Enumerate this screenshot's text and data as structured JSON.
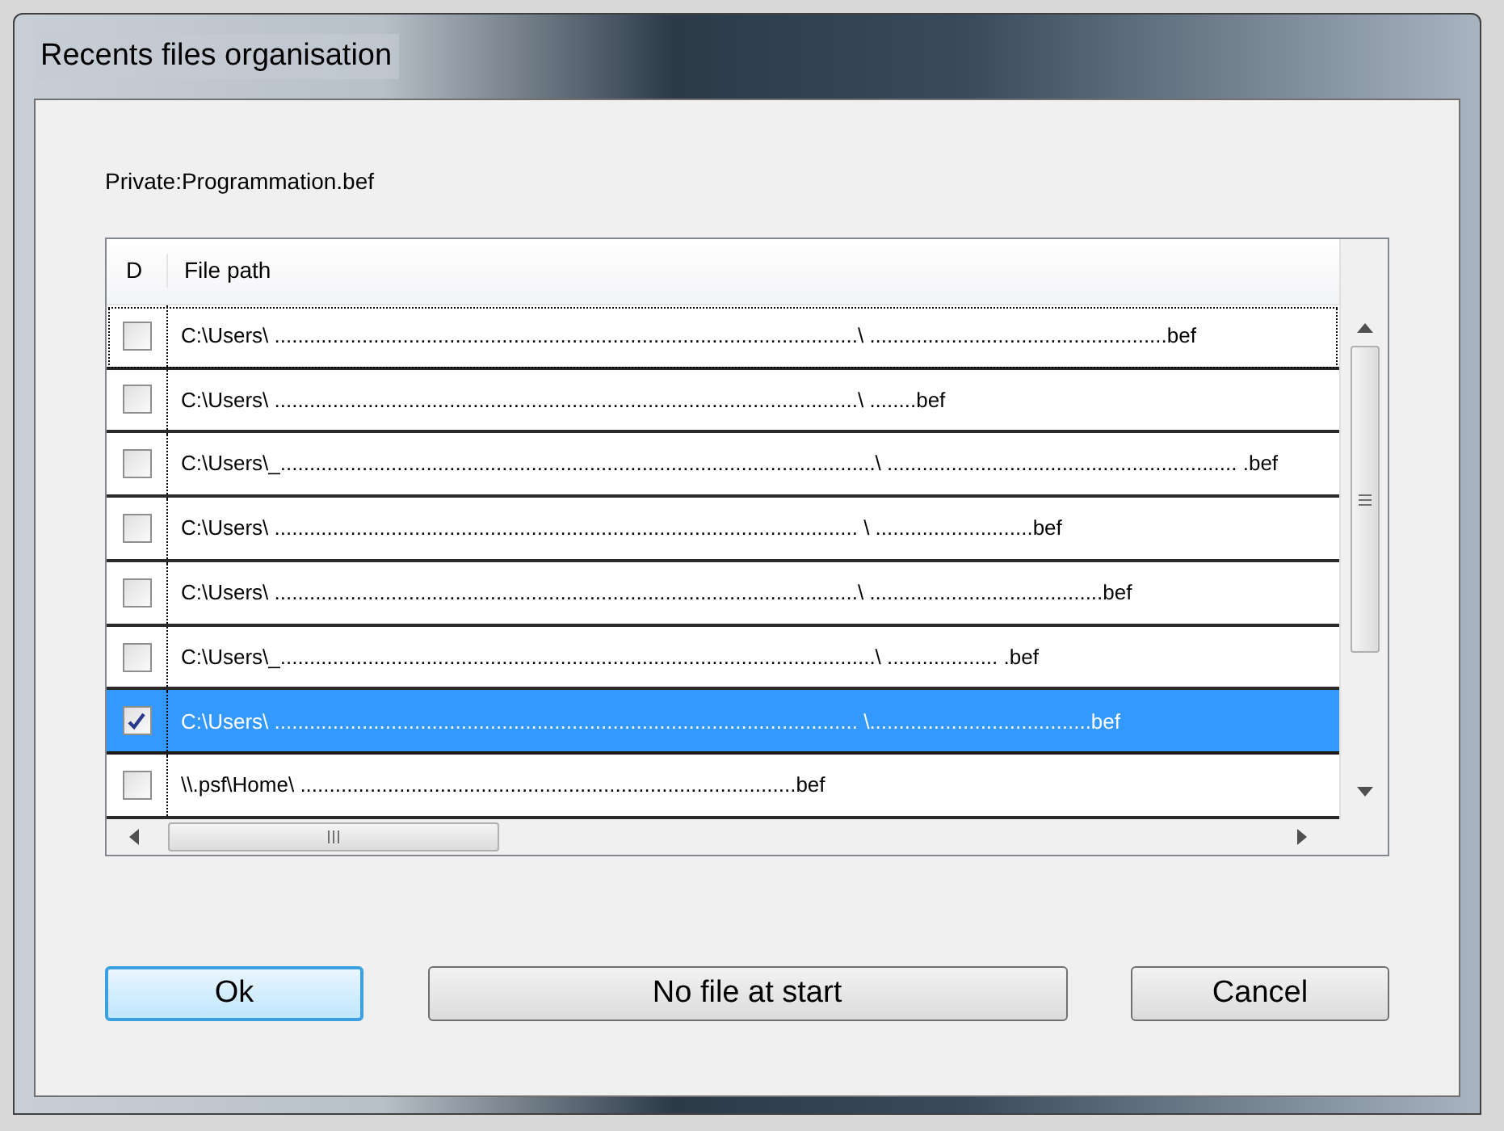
{
  "window": {
    "title": "Recents files organisation"
  },
  "label": "Private:Programmation.bef",
  "table": {
    "columns": [
      "D",
      "File path"
    ],
    "rows": [
      {
        "path": "C:\\Users\\ ....................................................................................................\\ ...................................................bef",
        "checked": false,
        "selected": false,
        "focused": true
      },
      {
        "path": "C:\\Users\\ ....................................................................................................\\ ........bef",
        "checked": false,
        "selected": false,
        "focused": false
      },
      {
        "path": "C:\\Users\\_......................................................................................................\\ ............................................................ .bef",
        "checked": false,
        "selected": false,
        "focused": false
      },
      {
        "path": "C:\\Users\\ .................................................................................................... \\ ...........................bef",
        "checked": false,
        "selected": false,
        "focused": false
      },
      {
        "path": "C:\\Users\\ ....................................................................................................\\ ........................................bef",
        "checked": false,
        "selected": false,
        "focused": false
      },
      {
        "path": "C:\\Users\\_......................................................................................................\\ ................... .bef",
        "checked": false,
        "selected": false,
        "focused": false
      },
      {
        "path": "C:\\Users\\ .................................................................................................... \\......................................bef",
        "checked": true,
        "selected": true,
        "focused": false
      },
      {
        "path": "\\\\.psf\\Home\\ .....................................................................................bef",
        "checked": false,
        "selected": false,
        "focused": false
      }
    ]
  },
  "buttons": [
    {
      "label": "Ok",
      "default": true
    },
    {
      "label": "No file at start",
      "default": false
    },
    {
      "label": "Cancel",
      "default": false
    }
  ]
}
